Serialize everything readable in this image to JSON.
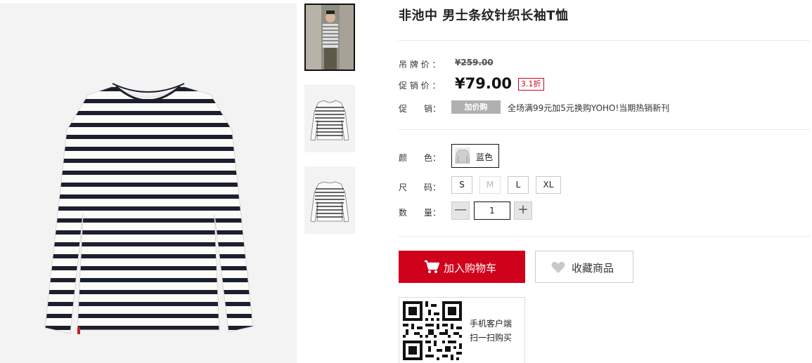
{
  "product": {
    "title": "非池中 男士条纹针织长袖T恤"
  },
  "price": {
    "tag_label": "吊 牌 价 ：",
    "tag_value": "¥259.00",
    "sale_label": "促 销 价 ：",
    "sale_value": "¥79.00",
    "discount": "3.1折",
    "accent_color": "#d0021b"
  },
  "promotion": {
    "label": "促　　销：",
    "badge": "加价购",
    "text": "全场满99元加5元换购YOHO!当期热销新刊"
  },
  "color": {
    "label": "颜　　色：",
    "selected": "蓝色"
  },
  "size": {
    "label": "尺　　码：",
    "options": [
      "S",
      "M",
      "L",
      "XL"
    ],
    "disabled": [
      "M"
    ]
  },
  "quantity": {
    "label": "数　　量：",
    "value": "1",
    "minus": "—",
    "plus": "+"
  },
  "actions": {
    "add_to_cart": "加入购物车",
    "favorite": "收藏商品"
  },
  "qr": {
    "line1": "手机客户端",
    "line2": "扫一扫购买"
  }
}
